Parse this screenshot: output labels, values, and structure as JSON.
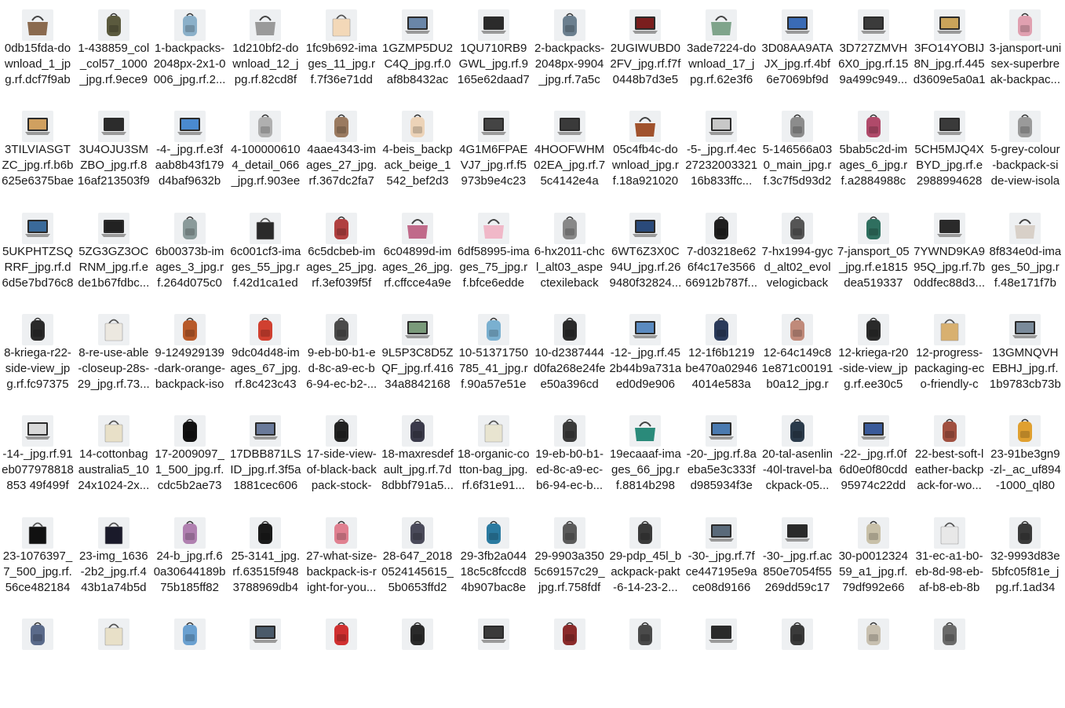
{
  "view": {
    "name": "file-explorer-large-icons"
  },
  "files": [
    {
      "label": "0db15fda-download_1_jpg.rf.dcf7f9ab4...",
      "icon": "bag-icon",
      "color": "#8a6a4f"
    },
    {
      "label": "1-438859_col_col57_1000_jpg.rf.9ece97...",
      "icon": "backpack-icon",
      "color": "#5b5a3e"
    },
    {
      "label": "1-backpacks-2048px-2x1-0006_jpg.rf.2...",
      "icon": "backpack-icon",
      "color": "#8bb0c9"
    },
    {
      "label": "1d210bf2-download_12_jpg.rf.82cd8f8...",
      "icon": "bag-icon",
      "color": "#9a9a9a"
    },
    {
      "label": "1fc9b692-images_11_jpg.rf.7f36e71dd8...",
      "icon": "tote-icon",
      "color": "#f3d8b8"
    },
    {
      "label": "1GZMP5DU2C4Q_jpg.rf.0af8b8432ac1...",
      "icon": "laptop-icon",
      "color": "#6a86a8"
    },
    {
      "label": "1QU710RB9GWL_jpg.rf.9165e62daad7dc...",
      "icon": "laptop-icon",
      "color": "#2b2b2b"
    },
    {
      "label": "2-backpacks-2048px-9904_jpg.rf.7a5c0...",
      "icon": "backpack-icon",
      "color": "#6b7f8f"
    },
    {
      "label": "2UGIWUBD02FV_jpg.rf.f7f0448b7d3e53...",
      "icon": "laptop-icon",
      "color": "#7a1e1e"
    },
    {
      "label": "3ade7224-download_17_jpg.rf.62e3f6b...",
      "icon": "bag-icon",
      "color": "#7fa48b"
    },
    {
      "label": "3D08AA9ATAJX_jpg.rf.4bf6e7069bf9df...",
      "icon": "laptop-icon",
      "color": "#3a6bb5"
    },
    {
      "label": "3D727ZMVH6X0_jpg.rf.159a499c949...",
      "icon": "laptop-icon",
      "color": "#3b3b3b"
    },
    {
      "label": "3FO14YOBIJ8N_jpg.rf.445d3609e5a0a12...",
      "icon": "laptop-icon",
      "color": "#c9a35a"
    },
    {
      "label": "3-jansport-unisex-superbreak-backpac...",
      "icon": "backpack-icon",
      "color": "#e0a0b0"
    },
    {
      "label": "3TILVIASGTZC_jpg.rf.b6b625e6375bae1...",
      "icon": "laptop-icon",
      "color": "#d0a060"
    },
    {
      "label": "3U4OJU3SMZBO_jpg.rf.816af213503f99...",
      "icon": "laptop-icon",
      "color": "#2c2c2c"
    },
    {
      "label": "-4-_jpg.rf.e3faab8b43f179d4baf9632b7...",
      "icon": "laptop-icon",
      "color": "#4a8ad0"
    },
    {
      "label": "4-1000006104_detail_066_jpg.rf.903eef...",
      "icon": "backpack-icon",
      "color": "#b0b0b0"
    },
    {
      "label": "4aae4343-images_27_jpg.rf.367dc2fa7a...",
      "icon": "backpack-icon",
      "color": "#9a7a60"
    },
    {
      "label": "4-beis_backpack_beige_1542_bef2d3b...",
      "icon": "backpack-icon",
      "color": "#ecd3b8"
    },
    {
      "label": "4G1M6FPAEVJ7_jpg.rf.f5973b9e4c234...",
      "icon": "laptop-icon",
      "color": "#444444"
    },
    {
      "label": "4HOOFWHM02EA_jpg.rf.75c4142e4a0...",
      "icon": "laptop-icon",
      "color": "#3a3a3a"
    },
    {
      "label": "05c4fb4c-download_jpg.rf.18a921020b...",
      "icon": "bag-icon",
      "color": "#a0522d"
    },
    {
      "label": "-5-_jpg.rf.4ec2723200332116b833ffc...",
      "icon": "laptop-icon",
      "color": "#c8c8c8"
    },
    {
      "label": "5-146566a030_main_jpg.rf.3c7f5d93d25...",
      "icon": "backpack-icon",
      "color": "#8c8c8c"
    },
    {
      "label": "5bab5c2d-images_6_jpg.rf.a2884988cf...",
      "icon": "backpack-icon",
      "color": "#b04a6a"
    },
    {
      "label": "5CH5MJQ4XBYD_jpg.rf.e29889946280...",
      "icon": "laptop-icon",
      "color": "#3a3a3a"
    },
    {
      "label": "5-grey-colour-backpack-side-view-isolat...",
      "icon": "backpack-icon",
      "color": "#9a9a9a"
    },
    {
      "label": "5UKPHTZSQRRF_jpg.rf.d6d5e7bd76c8e...",
      "icon": "laptop-icon",
      "color": "#3a6a9a"
    },
    {
      "label": "5ZG3GZ3OCRNM_jpg.rf.ede1b67fdbc...",
      "icon": "laptop-icon",
      "color": "#222222"
    },
    {
      "label": "6b00373b-images_3_jpg.rf.264d075c0d...",
      "icon": "backpack-icon",
      "color": "#8a9a9a"
    },
    {
      "label": "6c001cf3-images_55_jpg.rf.42d1ca1ed1...",
      "icon": "tote-icon",
      "color": "#2a2a2a"
    },
    {
      "label": "6c5dcbeb-images_25_jpg.rf.3ef039f5fd...",
      "icon": "backpack-icon",
      "color": "#b04040"
    },
    {
      "label": "6c04899d-images_26_jpg.rf.cffcce4a9e1...",
      "icon": "bag-icon",
      "color": "#c06a8a"
    },
    {
      "label": "6df58995-images_75_jpg.rf.bfce6edde3...",
      "icon": "bag-icon",
      "color": "#f0b8c8"
    },
    {
      "label": "6-hx2011-chcl_alt03_aspectexilebackp...",
      "icon": "backpack-icon",
      "color": "#888888"
    },
    {
      "label": "6WT6Z3X0C94U_jpg.rf.269480f32824...",
      "icon": "laptop-icon",
      "color": "#2a4a7a"
    },
    {
      "label": "7-d03218e626f4c17e356666912b787f...",
      "icon": "backpack-icon",
      "color": "#1f1f1f"
    },
    {
      "label": "7-hx1994-gycd_alt02_evolvelogicbackp...",
      "icon": "backpack-icon",
      "color": "#555555"
    },
    {
      "label": "7-jansport_05_jpg.rf.e1815dea5193374...",
      "icon": "backpack-icon",
      "color": "#2f6f5f"
    },
    {
      "label": "7YWND9KA995Q_jpg.rf.7b0ddfec88d3...",
      "icon": "laptop-icon",
      "color": "#2a2a2a"
    },
    {
      "label": "8f834e0d-images_50_jpg.rf.48e171f7b6...",
      "icon": "bag-icon",
      "color": "#d8d0c8"
    },
    {
      "label": "8-kriega-r22-side-view_jpg.rf.fc973750...",
      "icon": "backpack-icon",
      "color": "#2a2a2a"
    },
    {
      "label": "8-re-use-able-closeup-28s-29_jpg.rf.73...",
      "icon": "tote-icon",
      "color": "#ece8e0"
    },
    {
      "label": "9-124929139-dark-orange-backpack-isol...",
      "icon": "backpack-icon",
      "color": "#b85a2a"
    },
    {
      "label": "9dc04d48-images_67_jpg.rf.8c423c437...",
      "icon": "backpack-icon",
      "color": "#d04030"
    },
    {
      "label": "9-eb-b0-b1-ed-8c-a9-ec-b6-94-ec-b2-...",
      "icon": "backpack-icon",
      "color": "#4a4a4a"
    },
    {
      "label": "9L5P3C8D5ZQF_jpg.rf.41634a8842168d...",
      "icon": "laptop-icon",
      "color": "#7a9a7a"
    },
    {
      "label": "10-51371750785_41_jpg.rf.90a57e51e1...",
      "icon": "backpack-icon",
      "color": "#7ab0d0"
    },
    {
      "label": "10-d2387444d0fa268e24fee50a396cd7...",
      "icon": "backpack-icon",
      "color": "#2a2a2a"
    },
    {
      "label": "-12-_jpg.rf.452b44b9a731aed0d9e9063...",
      "icon": "laptop-icon",
      "color": "#5a8ac0"
    },
    {
      "label": "12-1f6b1219be470a029464014e583a2...",
      "icon": "backpack-icon",
      "color": "#2a3a5a"
    },
    {
      "label": "12-64c149c81e871c00191b0a12_jpg.rf...",
      "icon": "backpack-icon",
      "color": "#c08a7a"
    },
    {
      "label": "12-kriega-r20-side-view_jpg.rf.ee30c52...",
      "icon": "backpack-icon",
      "color": "#2a2a2a"
    },
    {
      "label": "12-progress-packaging-eco-friendly-ca...",
      "icon": "tote-icon",
      "color": "#d8b070"
    },
    {
      "label": "13GMNQVHEBHJ_jpg.rf.1b9783cb73b42...",
      "icon": "laptop-icon",
      "color": "#7a8a9a"
    },
    {
      "label": "-14-_jpg.rf.91eb077978818853 49f499f5...",
      "icon": "laptop-icon",
      "color": "#d8d8d8"
    },
    {
      "label": "14-cottonbagaustralia5_1024x1024-2x...",
      "icon": "tote-icon",
      "color": "#e8e0c8"
    },
    {
      "label": "17-2009097_1_500_jpg.rf.cdc5b2ae734...",
      "icon": "backpack-icon",
      "color": "#111111"
    },
    {
      "label": "17DBB871LSID_jpg.rf.3f5a1881cec606b...",
      "icon": "laptop-icon",
      "color": "#6a7a9a"
    },
    {
      "label": "17-side-view-of-black-backpack-stock-i...",
      "icon": "backpack-icon",
      "color": "#222222"
    },
    {
      "label": "18-maxresdefault_jpg.rf.7d8dbbf791a5...",
      "icon": "backpack-icon",
      "color": "#3a3a4a"
    },
    {
      "label": "18-organic-cotton-bag_jpg.rf.6f31e91...",
      "icon": "tote-icon",
      "color": "#e8e4d0"
    },
    {
      "label": "19-eb-b0-b1-ed-8c-a9-ec-b6-94-ec-b...",
      "icon": "backpack-icon",
      "color": "#3a3a3a"
    },
    {
      "label": "19ecaaaf-images_66_jpg.rf.8814b298b...",
      "icon": "bag-icon",
      "color": "#2a8a7a"
    },
    {
      "label": "-20-_jpg.rf.8aeba5e3c333fd985934f3e4...",
      "icon": "laptop-icon",
      "color": "#4a7ab0"
    },
    {
      "label": "20-tal-asenlin-40l-travel-backpack-05...",
      "icon": "backpack-icon",
      "color": "#2a3a4a"
    },
    {
      "label": "-22-_jpg.rf.0f6d0e0f80cdd95974c22dd7...",
      "icon": "laptop-icon",
      "color": "#3a5a9a"
    },
    {
      "label": "22-best-soft-leather-backpack-for-wo...",
      "icon": "backpack-icon",
      "color": "#a05040"
    },
    {
      "label": "23-91be3gn9-zl-_ac_uf894-1000_ql80_...",
      "icon": "backpack-icon",
      "color": "#e0a030"
    },
    {
      "label": "23-1076397_7_500_jpg.rf.56ce482184f...",
      "icon": "tote-icon",
      "color": "#111111"
    },
    {
      "label": "23-img_1636-2b2_jpg.rf.443b1a74b5d8...",
      "icon": "tote-icon",
      "color": "#1a1a2a"
    },
    {
      "label": "24-b_jpg.rf.60a30644189b75b185ff826...",
      "icon": "backpack-icon",
      "color": "#b080b0"
    },
    {
      "label": "25-3141_jpg.rf.63515f9483788969db48...",
      "icon": "backpack-icon",
      "color": "#1a1a1a"
    },
    {
      "label": "27-what-size-backpack-is-right-for-you...",
      "icon": "backpack-icon",
      "color": "#e08090"
    },
    {
      "label": "28-647_20180524145615_5b0653ffd28...",
      "icon": "backpack-icon",
      "color": "#4a4a5a"
    },
    {
      "label": "29-3fb2a04418c5c8fccd84b907bac8e5...",
      "icon": "backpack-icon",
      "color": "#2a7aa0"
    },
    {
      "label": "29-9903a3505c69157c29_jpg.rf.758fdf9...",
      "icon": "backpack-icon",
      "color": "#5a5a5a"
    },
    {
      "label": "29-pdp_45l_backpack-pakt-6-14-23-2...",
      "icon": "backpack-icon",
      "color": "#3a3a3a"
    },
    {
      "label": "-30-_jpg.rf.7fce447195e9ace08d9166c...",
      "icon": "laptop-icon",
      "color": "#5a6a7a"
    },
    {
      "label": "-30-_jpg.rf.ac850e7054f55269dd59c174...",
      "icon": "laptop-icon",
      "color": "#2a2a2a"
    },
    {
      "label": "30-p001232459_a1_jpg.rf.79df992e662...",
      "icon": "backpack-icon",
      "color": "#c8c0a8"
    },
    {
      "label": "31-ec-a1-b0-eb-8d-98-eb-af-b8-eb-8b-...",
      "icon": "tote-icon",
      "color": "#e8e8e8"
    },
    {
      "label": "32-9993d83e5bfc05f81e_jpg.rf.1ad34d...",
      "icon": "backpack-icon",
      "color": "#3a3a3a"
    },
    {
      "label": "",
      "icon": "backpack-icon",
      "color": "#5a6a8a"
    },
    {
      "label": "",
      "icon": "tote-icon",
      "color": "#e8e0c8"
    },
    {
      "label": "",
      "icon": "backpack-icon",
      "color": "#6aa0d0"
    },
    {
      "label": "",
      "icon": "laptop-icon",
      "color": "#4a5a6a"
    },
    {
      "label": "",
      "icon": "backpack-icon",
      "color": "#d03030"
    },
    {
      "label": "",
      "icon": "backpack-icon",
      "color": "#2a2a2a"
    },
    {
      "label": "",
      "icon": "laptop-icon",
      "color": "#3a3a3a"
    },
    {
      "label": "",
      "icon": "backpack-icon",
      "color": "#8a2a2a"
    },
    {
      "label": "",
      "icon": "backpack-icon",
      "color": "#4a4a4a"
    },
    {
      "label": "",
      "icon": "laptop-icon",
      "color": "#2a2a2a"
    },
    {
      "label": "",
      "icon": "backpack-icon",
      "color": "#3a3a3a"
    },
    {
      "label": "",
      "icon": "backpack-icon",
      "color": "#c8c0b0"
    },
    {
      "label": "",
      "icon": "backpack-icon",
      "color": "#6a6a6a"
    }
  ]
}
